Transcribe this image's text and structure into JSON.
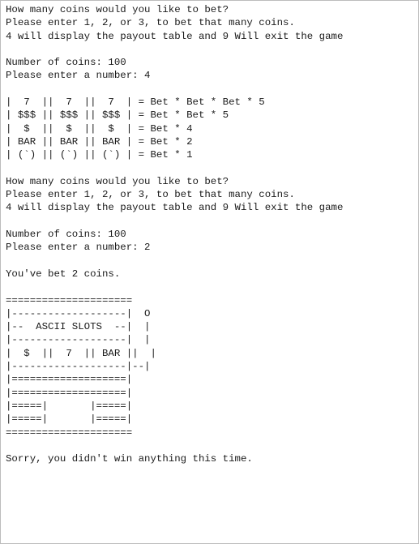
{
  "console": {
    "lines": [
      "How many coins would you like to bet?",
      "Please enter 1, 2, or 3, to bet that many coins.",
      "4 will display the payout table and 9 Will exit the game",
      "",
      "Number of coins: 100",
      "Please enter a number: 4",
      "",
      "|  7  ||  7  ||  7  | = Bet * Bet * Bet * 5",
      "| $$$ || $$$ || $$$ | = Bet * Bet * 5",
      "|  $  ||  $  ||  $  | = Bet * 4",
      "| BAR || BAR || BAR | = Bet * 2",
      "| (`) || (`) || (`) | = Bet * 1",
      "",
      "How many coins would you like to bet?",
      "Please enter 1, 2, or 3, to bet that many coins.",
      "4 will display the payout table and 9 Will exit the game",
      "",
      "Number of coins: 100",
      "Please enter a number: 2",
      "",
      "You've bet 2 coins.",
      "",
      "=====================",
      "|-------------------|  O",
      "|--  ASCII SLOTS  --|  |",
      "|-------------------|  |",
      "|  $  ||  7  || BAR ||  |",
      "|-------------------|--|",
      "|===================|",
      "|===================|",
      "|=====|       |=====|",
      "|=====|       |=====|",
      "=====================",
      "",
      "Sorry, you didn't win anything this time."
    ]
  }
}
